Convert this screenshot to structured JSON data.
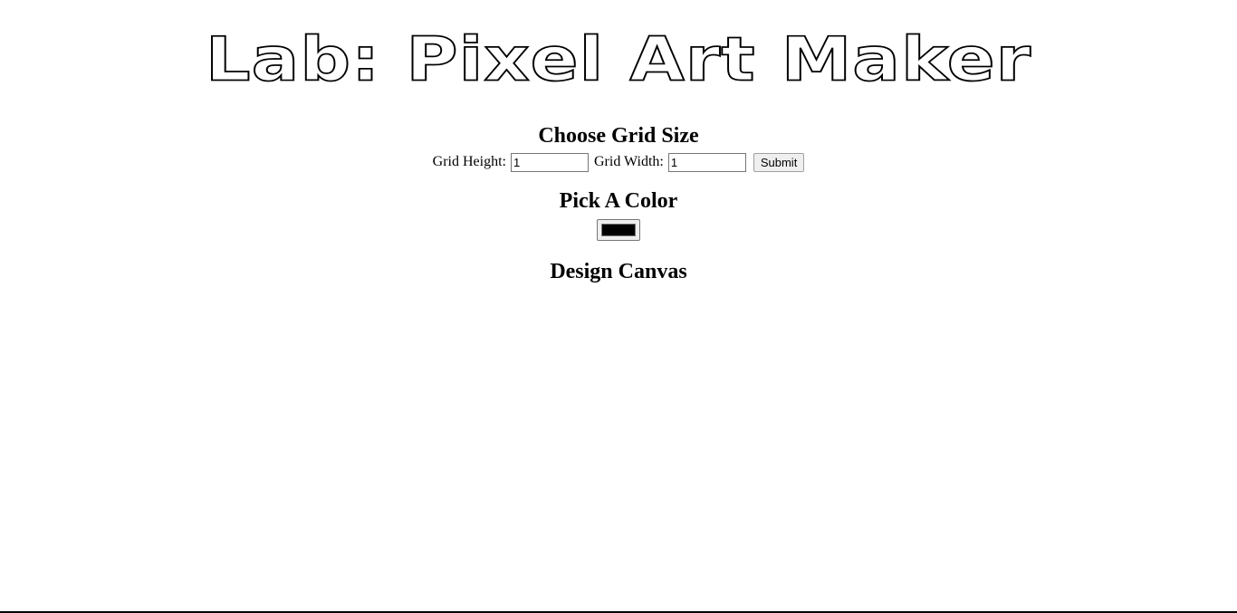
{
  "header": {
    "title": "Lab: Pixel Art Maker"
  },
  "grid_size": {
    "heading": "Choose Grid Size",
    "height_label": "Grid Height:",
    "height_value": "1",
    "width_label": "Grid Width:",
    "width_value": "1",
    "submit_label": "Submit"
  },
  "color": {
    "heading": "Pick A Color",
    "value": "#000000"
  },
  "canvas": {
    "heading": "Design Canvas"
  }
}
